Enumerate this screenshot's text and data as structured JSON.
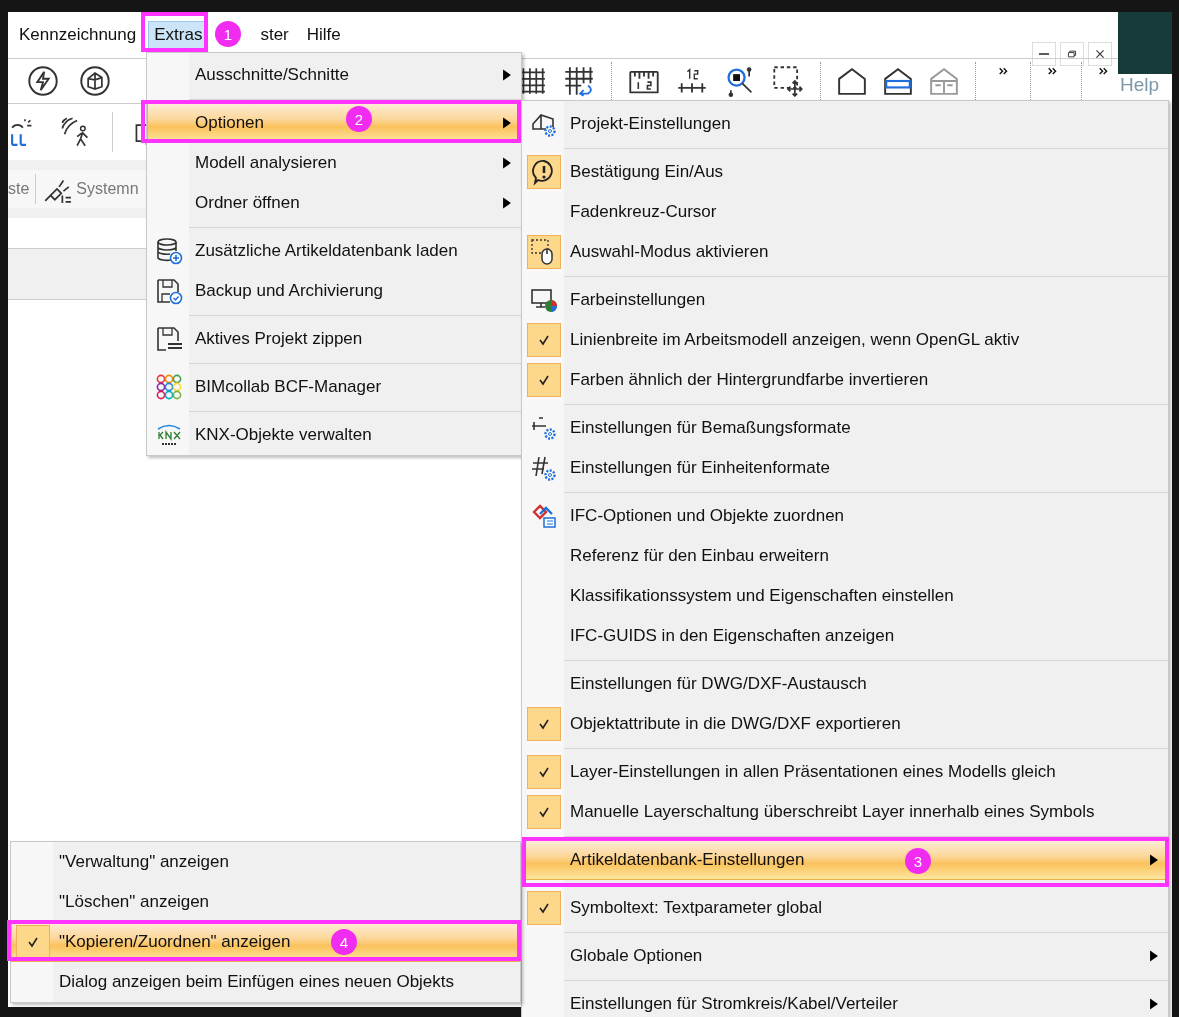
{
  "menubar": [
    {
      "label": "Kennzeichnung",
      "selected": false
    },
    {
      "label": "Extras",
      "selected": true
    },
    {
      "label": "ster",
      "selected": false
    },
    {
      "label": "Hilfe",
      "selected": false
    }
  ],
  "toolbar_texts": [
    "ste",
    "Systemn"
  ],
  "side_panel": {
    "text": "Help"
  },
  "extras_menu": {
    "groups": [
      [
        {
          "label": "Ausschnitte/Schnitte",
          "submenu": true,
          "selected": false
        }
      ],
      [
        {
          "label": "Optionen",
          "submenu": true,
          "selected": true
        },
        {
          "label": "Modell analysieren",
          "submenu": true,
          "selected": false
        },
        {
          "label": "Ordner öffnen",
          "submenu": true,
          "selected": false
        }
      ],
      [
        {
          "label": "Zusätzliche Artikeldatenbank laden",
          "submenu": false,
          "selected": false
        },
        {
          "label": "Backup und Archivierung",
          "submenu": false,
          "selected": false
        }
      ],
      [
        {
          "label": "Aktives Projekt zippen",
          "submenu": false,
          "selected": false
        }
      ],
      [
        {
          "label": "BIMcollab BCF-Manager",
          "submenu": false,
          "selected": false
        }
      ],
      [
        {
          "label": "KNX-Objekte verwalten",
          "submenu": false,
          "selected": false
        }
      ]
    ]
  },
  "options_menu": {
    "groups": [
      [
        {
          "label": "Projekt-Einstellungen",
          "checked": false,
          "submenu": false,
          "selected": false
        }
      ],
      [
        {
          "label": "Bestätigung Ein/Aus",
          "checked": true,
          "submenu": false,
          "selected": false
        },
        {
          "label": "Fadenkreuz-Cursor",
          "checked": false,
          "submenu": false,
          "selected": false
        },
        {
          "label": "Auswahl-Modus aktivieren",
          "checked": true,
          "submenu": false,
          "selected": false
        }
      ],
      [
        {
          "label": "Farbeinstellungen",
          "checked": false,
          "submenu": false,
          "selected": false
        },
        {
          "label": "Linienbreite im Arbeitsmodell anzeigen, wenn OpenGL aktiv",
          "checked": true,
          "submenu": false,
          "selected": false
        },
        {
          "label": "Farben ähnlich der Hintergrundfarbe invertieren",
          "checked": true,
          "submenu": false,
          "selected": false
        }
      ],
      [
        {
          "label": "Einstellungen für Bemaßungsformate",
          "checked": false,
          "submenu": false,
          "selected": false
        },
        {
          "label": "Einstellungen für Einheitenformate",
          "checked": false,
          "submenu": false,
          "selected": false
        }
      ],
      [
        {
          "label": "IFC-Optionen und Objekte zuordnen",
          "checked": false,
          "submenu": false,
          "selected": false
        },
        {
          "label": "Referenz für den Einbau erweitern",
          "checked": false,
          "submenu": false,
          "selected": false
        },
        {
          "label": "Klassifikationssystem und Eigenschaften einstellen",
          "checked": false,
          "submenu": false,
          "selected": false
        },
        {
          "label": "IFC-GUIDS in den Eigenschaften anzeigen",
          "checked": false,
          "submenu": false,
          "selected": false
        }
      ],
      [
        {
          "label": "Einstellungen für DWG/DXF-Austausch",
          "checked": false,
          "submenu": false,
          "selected": false
        },
        {
          "label": "Objektattribute in die DWG/DXF exportieren",
          "checked": true,
          "submenu": false,
          "selected": false
        }
      ],
      [
        {
          "label": "Layer-Einstellungen in allen Präsentationen eines Modells gleich",
          "checked": true,
          "submenu": false,
          "selected": false
        },
        {
          "label": "Manuelle Layerschaltung überschreibt Layer innerhalb eines Symbols",
          "checked": true,
          "submenu": false,
          "selected": false
        }
      ],
      [
        {
          "label": "Artikeldatenbank-Einstellungen",
          "checked": false,
          "submenu": true,
          "selected": true
        }
      ],
      [
        {
          "label": "Symboltext: Textparameter global",
          "checked": true,
          "submenu": false,
          "selected": false
        }
      ],
      [
        {
          "label": "Globale Optionen",
          "checked": false,
          "submenu": true,
          "selected": false
        }
      ],
      [
        {
          "label": "Einstellungen für Stromkreis/Kabel/Verteiler",
          "checked": false,
          "submenu": true,
          "selected": false
        }
      ]
    ]
  },
  "article_db_menu": {
    "items": [
      {
        "label": "\"Verwaltung\" anzeigen",
        "checked": false,
        "selected": false
      },
      {
        "label": "\"Löschen\" anzeigen",
        "checked": false,
        "selected": false
      },
      {
        "label": "\"Kopieren/Zuordnen\" anzeigen",
        "checked": true,
        "selected": true
      },
      {
        "label": "Dialog anzeigen beim Einfügen eines neuen Objekts",
        "checked": false,
        "selected": false
      }
    ]
  },
  "callouts": [
    {
      "number": "1"
    },
    {
      "number": "2"
    },
    {
      "number": "3"
    },
    {
      "number": "4"
    }
  ]
}
